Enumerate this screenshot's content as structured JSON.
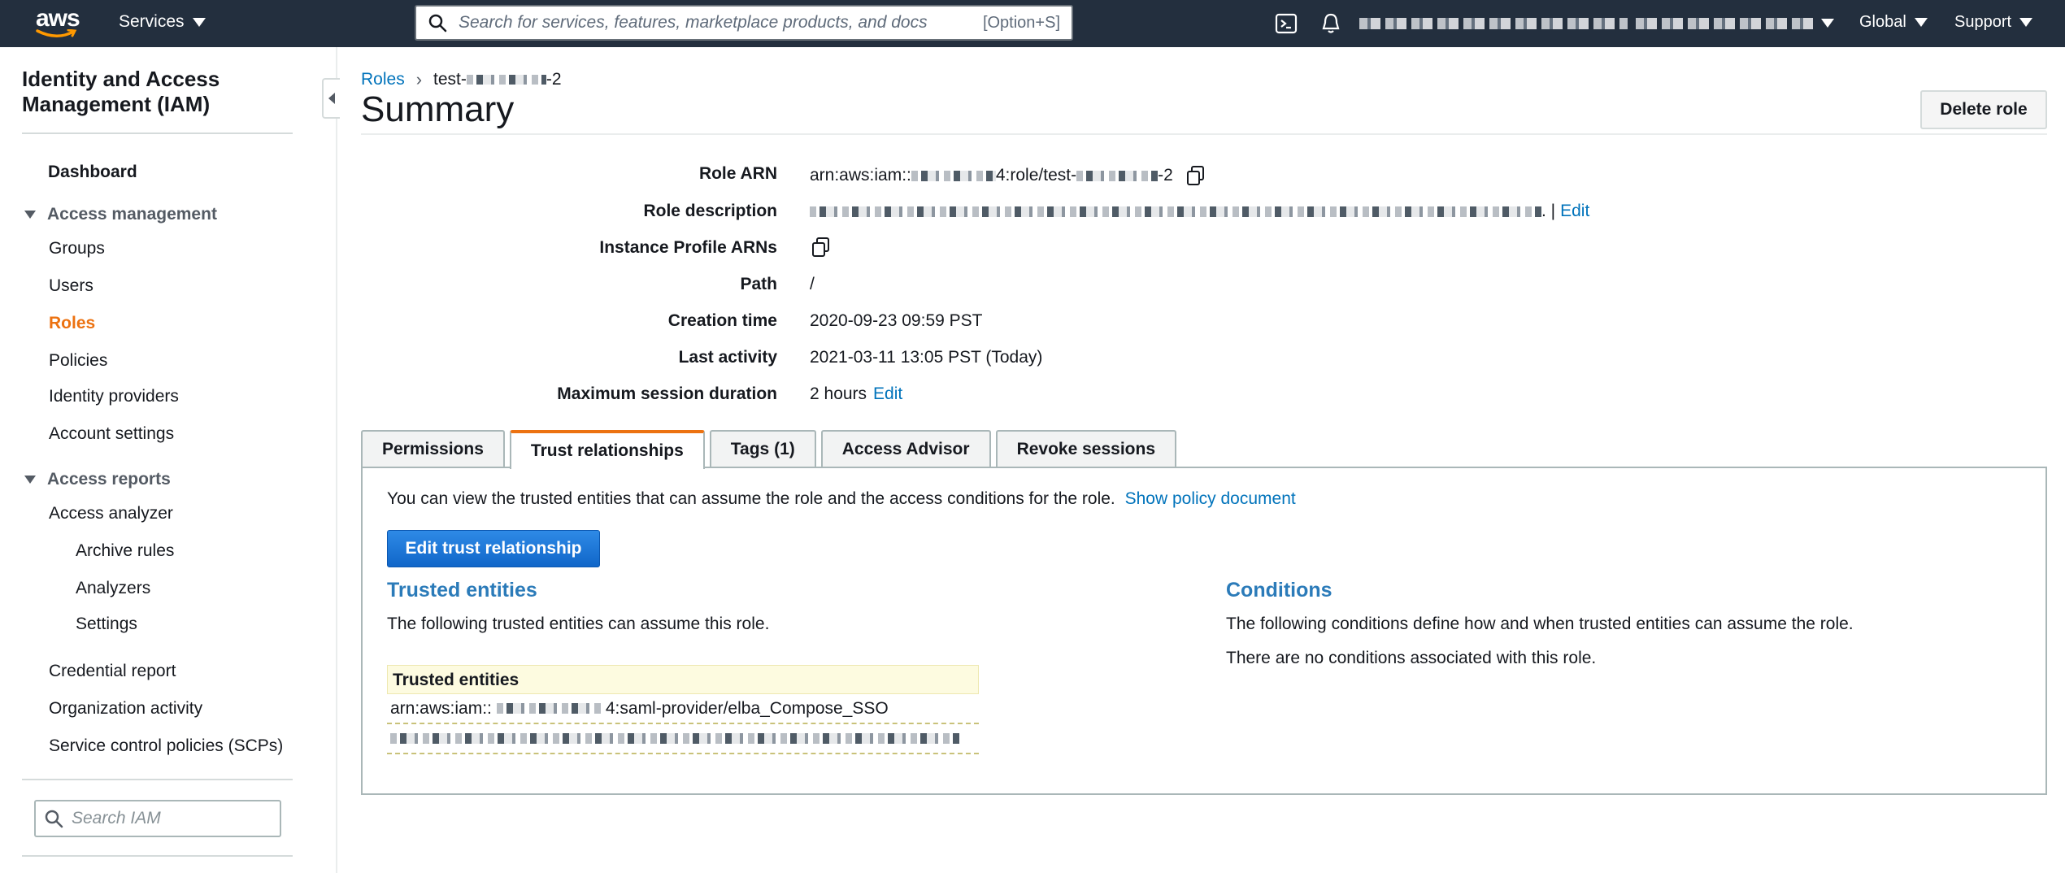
{
  "topnav": {
    "logo_text": "aws",
    "services_label": "Services",
    "search_placeholder": "Search for services, features, marketplace products, and docs",
    "search_shortcut": "[Option+S]",
    "region_label": "Global",
    "support_label": "Support",
    "icons": [
      "cloudshell-icon",
      "bell-icon"
    ]
  },
  "sidebar": {
    "title": "Identity and Access Management (IAM)",
    "dashboard": "Dashboard",
    "access_management": "Access management",
    "groups": "Groups",
    "users": "Users",
    "roles": "Roles",
    "policies": "Policies",
    "identity_providers": "Identity providers",
    "account_settings": "Account settings",
    "access_reports": "Access reports",
    "access_analyzer": "Access analyzer",
    "archive_rules": "Archive rules",
    "analyzers": "Analyzers",
    "settings": "Settings",
    "credential_report": "Credential report",
    "organization_activity": "Organization activity",
    "scps": "Service control policies (SCPs)",
    "search_placeholder": "Search IAM"
  },
  "breadcrumb": {
    "roles": "Roles",
    "current_prefix": "test-",
    "current_suffix": "-2"
  },
  "page": {
    "title": "Summary",
    "delete_button": "Delete role"
  },
  "summary": {
    "role_arn_label": "Role ARN",
    "role_arn_prefix": "arn:aws:iam::",
    "role_arn_middle": "4:role/test-",
    "role_arn_suffix": "-2",
    "role_description_label": "Role description",
    "role_description_edit": "Edit",
    "role_description_sep": ". |",
    "instance_profile_label": "Instance Profile ARNs",
    "path_label": "Path",
    "path_value": "/",
    "creation_time_label": "Creation time",
    "creation_time_value": "2020-09-23 09:59 PST",
    "last_activity_label": "Last activity",
    "last_activity_value": "2021-03-11 13:05 PST (Today)",
    "max_session_label": "Maximum session duration",
    "max_session_value": "2 hours",
    "max_session_edit": "Edit"
  },
  "tabs": [
    "Permissions",
    "Trust relationships",
    "Tags (1)",
    "Access Advisor",
    "Revoke sessions"
  ],
  "trust": {
    "intro": "You can view the trusted entities that can assume the role and the access conditions for the role.",
    "show_policy": "Show policy document",
    "edit_button": "Edit trust relationship",
    "trusted_heading": "Trusted entities",
    "trusted_text": "The following trusted entities can assume this role.",
    "table_header": "Trusted entities",
    "row1_prefix": "arn:aws:iam::",
    "row1_suffix": "4:saml-provider/elba_Compose_SSO",
    "conditions_heading": "Conditions",
    "conditions_text": "The following conditions define how and when trusted entities can assume the role.",
    "no_conditions": "There are no conditions associated with this role."
  }
}
